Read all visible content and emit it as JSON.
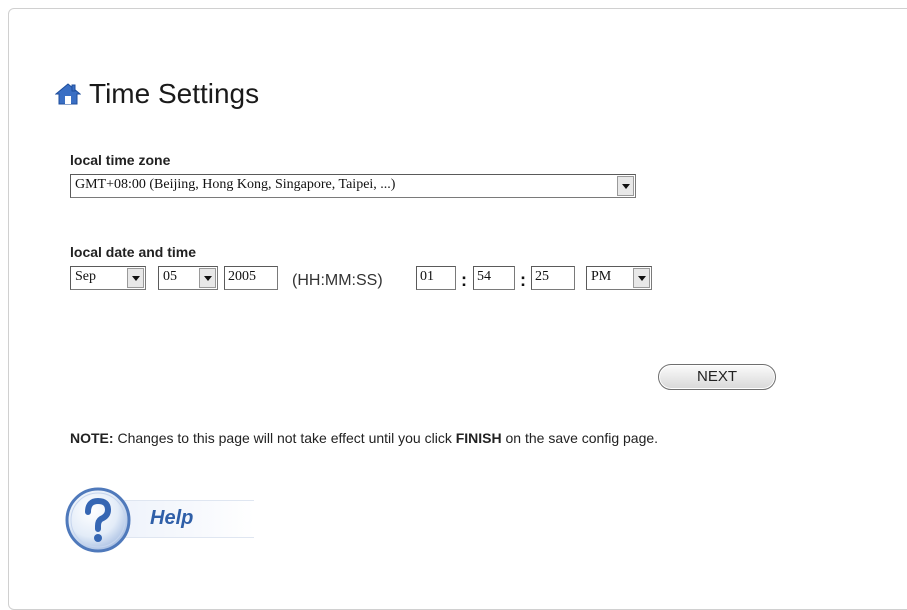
{
  "page": {
    "title": "Time Settings",
    "icon": "home-icon"
  },
  "timezone": {
    "label": "local time zone",
    "selected": "GMT+08:00 (Beijing, Hong Kong, Singapore, Taipei, ...)"
  },
  "datetime": {
    "label": "local date and time",
    "month": "Sep",
    "day": "05",
    "year": "2005",
    "format_label": "(HH:MM:SS)",
    "hour": "01",
    "minute": "54",
    "second": "25",
    "ampm": "PM",
    "separator": ":"
  },
  "actions": {
    "next_label": "NEXT"
  },
  "note": {
    "prefix": "NOTE:",
    "text_before": " Changes to this page will not take effect until you click ",
    "emphasis": "FINISH",
    "text_after": " on the save config page."
  },
  "help": {
    "label": "Help",
    "icon": "question-mark-icon"
  },
  "colors": {
    "help_blue": "#2f5fa8",
    "home_icon_blue": "#3a6fc4"
  }
}
